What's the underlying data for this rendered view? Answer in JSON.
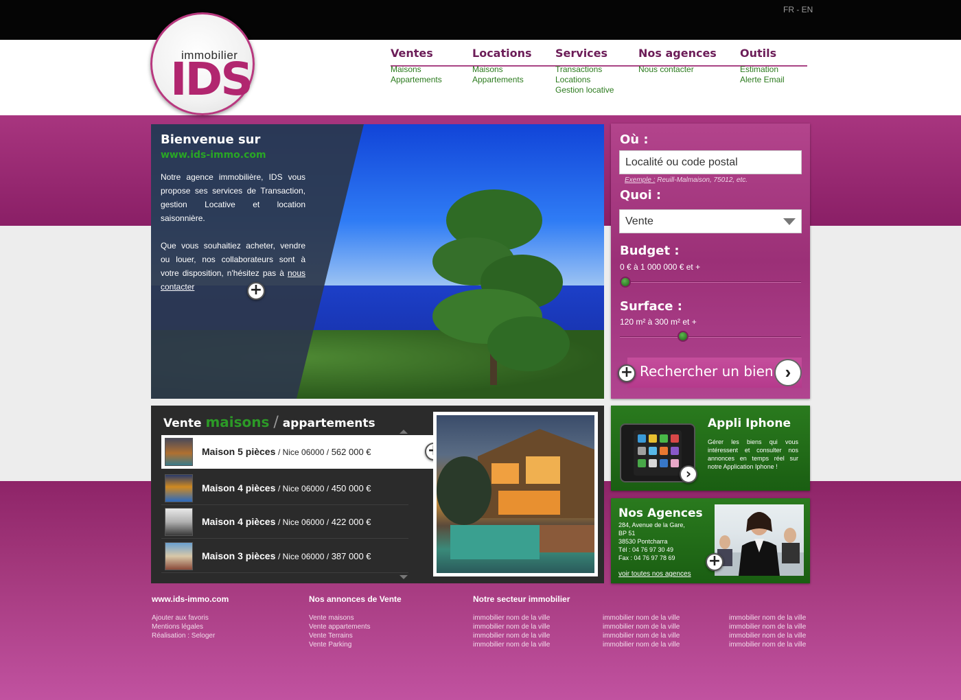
{
  "lang": "FR - EN",
  "logo": {
    "small": "immobilier",
    "big": "IDS"
  },
  "nav": [
    {
      "title": "Ventes",
      "items": [
        "Maisons",
        "Appartements"
      ]
    },
    {
      "title": "Locations",
      "items": [
        "Maisons",
        "Appartements"
      ]
    },
    {
      "title": "Services",
      "items": [
        "Transactions",
        "Locations",
        "Gestion locative"
      ]
    },
    {
      "title": "Nos agences",
      "items": [
        "Nous contacter"
      ]
    },
    {
      "title": "Outils",
      "items": [
        "Estimation",
        "Alerte Email"
      ]
    }
  ],
  "hero": {
    "title1": "Bienvenue sur",
    "title2": "www.ids-immo.com",
    "p1": "Notre agence immobilière, IDS vous propose ses services de Transaction, gestion Locative et location saisonnière.",
    "p2": "Que vous souhaitiez acheter, vendre ou louer, nos collaborateurs sont à votre disposition, n'hésitez pas à",
    "link": "nous contacter"
  },
  "search": {
    "ou_label": "Où :",
    "ou_placeholder": "Localité ou code postal",
    "example_label": "Exemple :",
    "example_text": "Reuill-Malmaison, 75012, etc.",
    "quoi_label": "Quoi :",
    "quoi_value": "Vente",
    "budget_label": "Budget :",
    "budget_range": "0 € à 1 000 000 € et +",
    "surface_label": "Surface :",
    "surface_range": "120 m² à 300 m² et +",
    "button": "Rechercher un bien"
  },
  "listing": {
    "title_vente": "Vente",
    "title_maisons": "maisons",
    "title_slash": "/",
    "title_appart": "appartements",
    "rows": [
      {
        "title": "Maison 5 pièces",
        "loc": "/ Nice 06000 /",
        "price": "562 000 €"
      },
      {
        "title": "Maison 4 pièces",
        "loc": "/ Nice 06000 /",
        "price": "450 000 €"
      },
      {
        "title": "Maison 4 pièces",
        "loc": "/ Nice 06000 /",
        "price": "422 000 €"
      },
      {
        "title": "Maison 3 pièces",
        "loc": "/ Nice 06000 /",
        "price": "387 000 €"
      }
    ]
  },
  "appli": {
    "title": "Appli Iphone",
    "text": "Gérer les biens qui vous intéressent et consulter nos annonces en temps réel sur notre Application Iphone !"
  },
  "agences": {
    "title": "Nos Agences",
    "lines": [
      "284, Avenue de la Gare,",
      "BP 51",
      "38530 Pontcharra",
      "Tél : 04 76 97 30 49",
      "Fax : 04 76 97 78 69"
    ],
    "link": "voir toutes nos agences"
  },
  "footer": {
    "col1": {
      "head": "www.ids-immo.com",
      "links": [
        "Ajouter aux favoris",
        "Mentions légales",
        "Réalisation : Seloger"
      ]
    },
    "col2": {
      "head": "Nos annonces de Vente",
      "links": [
        "Vente maisons",
        "Vente appartements",
        "Vente Terrains",
        "Vente Parking"
      ]
    },
    "col3": {
      "head": "Notre secteur immobilier",
      "links": [
        "immobilier nom de la ville",
        "immobilier nom de la ville",
        "immobilier nom de la ville",
        "immobilier nom de la ville"
      ]
    },
    "col4": {
      "links": [
        "immobilier nom de la ville",
        "immobilier nom de la ville",
        "immobilier nom de la ville",
        "immobilier nom de la ville"
      ]
    },
    "col5": {
      "links": [
        "immobilier nom de la ville",
        "immobilier nom de la ville",
        "immobilier nom de la ville",
        "immobilier nom de la ville"
      ]
    }
  }
}
